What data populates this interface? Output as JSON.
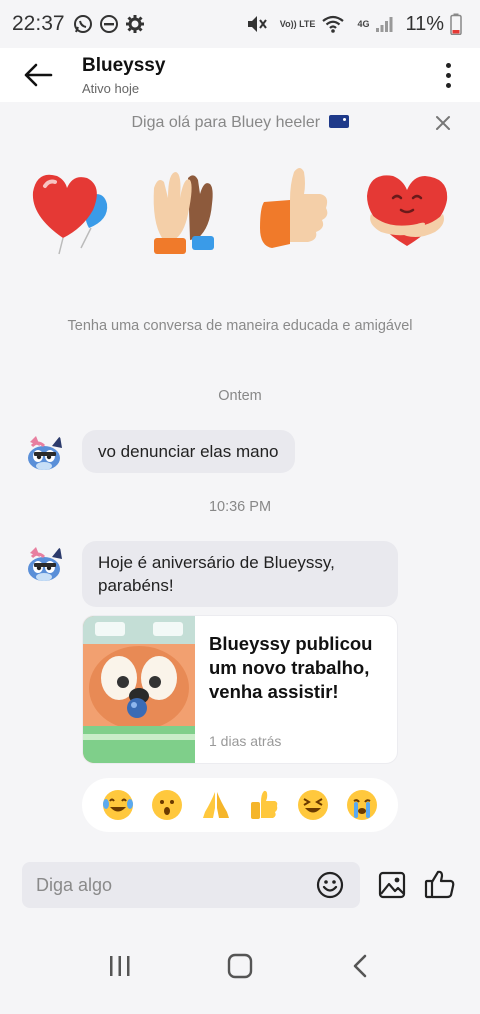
{
  "status_bar": {
    "time": "22:37",
    "volte": "Vo)) LTE",
    "network": "4G",
    "battery": "11%",
    "icons": [
      "whatsapp-icon",
      "do-not-disturb-icon",
      "settings-icon",
      "mute-icon",
      "wifi-icon",
      "signal-icon",
      "battery-icon"
    ]
  },
  "header": {
    "name": "Blueyssy",
    "status": "Ativo hoje",
    "back_icon": "back-arrow-icon",
    "more_icon": "more-vertical-icon"
  },
  "greet": {
    "text": "Diga olá para Bluey heeler",
    "flag_icon": "australia-flag-icon",
    "close_icon": "close-icon"
  },
  "stickers": [
    "heart-balloon-sticker",
    "high-five-sticker",
    "thumbs-up-sticker",
    "hug-heart-sticker"
  ],
  "hint": "Tenha uma conversa de maneira educada e amigável",
  "date_separator": "Ontem",
  "messages": [
    {
      "text": "vo denunciar elas mano"
    }
  ],
  "time_separator": "10:36 PM",
  "birthday_message": "Hoje é aniversário de Blueyssy, parabéns!",
  "card": {
    "title": "Blueyssy publicou um novo trabalho, venha assistir!",
    "time": "1 dias atrás"
  },
  "reactions": [
    "laugh-cry-emoji",
    "surprised-emoji",
    "pray-emoji",
    "thumbs-up-emoji",
    "squint-laugh-emoji",
    "loud-cry-emoji"
  ],
  "input": {
    "placeholder": "Diga algo",
    "emoji_icon": "smiley-icon",
    "image_icon": "image-icon",
    "like_icon": "like-icon"
  },
  "navbar": [
    "recents-icon",
    "home-icon",
    "back-icon"
  ],
  "colors": {
    "background": "#f5f5f7",
    "bubble": "#e9e9ee",
    "text": "#222222",
    "muted": "#888888"
  }
}
